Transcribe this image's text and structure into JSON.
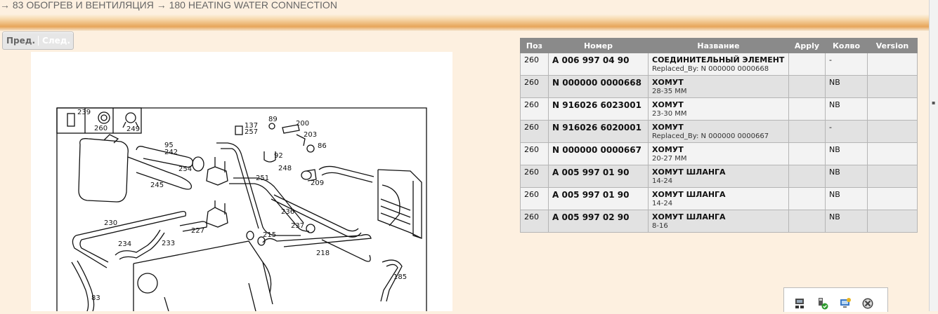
{
  "breadcrumb": "→ 83 ОБОГРЕВ И ВЕНТИЛЯЦИЯ → 180 HEATING WATER CONNECTION",
  "pager": {
    "prev_label": "Пред.",
    "next_label": "След."
  },
  "diagram": {
    "callouts": [
      "239",
      "260",
      "249",
      "137",
      "257",
      "89",
      "200",
      "203",
      "86",
      "95",
      "242",
      "92",
      "254",
      "248",
      "251",
      "209",
      "245",
      "230",
      "227",
      "236",
      "237",
      "215",
      "234",
      "233",
      "218",
      "83",
      "185"
    ]
  },
  "table": {
    "columns": [
      "Поз",
      "Номер",
      "Название",
      "Apply",
      "Колво",
      "Version"
    ],
    "rows": [
      {
        "pos": "260",
        "number": "A 006 997 04 90",
        "name": "СОЕДИНИТЕЛЬНЫЙ ЭЛЕМЕНТ",
        "note": "Replaced_By: N 000000 0000668",
        "apply": "",
        "qty": "-",
        "version": ""
      },
      {
        "pos": "260",
        "number": "N 000000 0000668",
        "name": "ХОМУТ",
        "note": "28-35 ММ",
        "apply": "",
        "qty": "NB",
        "version": ""
      },
      {
        "pos": "260",
        "number": "N 916026 6023001",
        "name": "ХОМУТ",
        "note": "23-30 ММ",
        "apply": "",
        "qty": "NB",
        "version": ""
      },
      {
        "pos": "260",
        "number": "N 916026 6020001",
        "name": "ХОМУТ",
        "note": "Replaced_By: N 000000 0000667",
        "apply": "",
        "qty": "-",
        "version": ""
      },
      {
        "pos": "260",
        "number": "N 000000 0000667",
        "name": "ХОМУТ",
        "note": "20-27 ММ",
        "apply": "",
        "qty": "NB",
        "version": ""
      },
      {
        "pos": "260",
        "number": "A 005 997 01 90",
        "name": "ХОМУТ ШЛАНГА",
        "note": "14-24",
        "apply": "",
        "qty": "NB",
        "version": ""
      },
      {
        "pos": "260",
        "number": "A 005 997 01 90",
        "name": "ХОМУТ ШЛАНГА",
        "note": "14-24",
        "apply": "",
        "qty": "NB",
        "version": ""
      },
      {
        "pos": "260",
        "number": "A 005 997 02 90",
        "name": "ХОМУТ ШЛАНГА",
        "note": "8-16",
        "apply": "",
        "qty": "NB",
        "version": ""
      }
    ]
  },
  "tray_icons": [
    "network-icon",
    "usb-check-icon",
    "monitor-icon",
    "antivirus-icon"
  ]
}
